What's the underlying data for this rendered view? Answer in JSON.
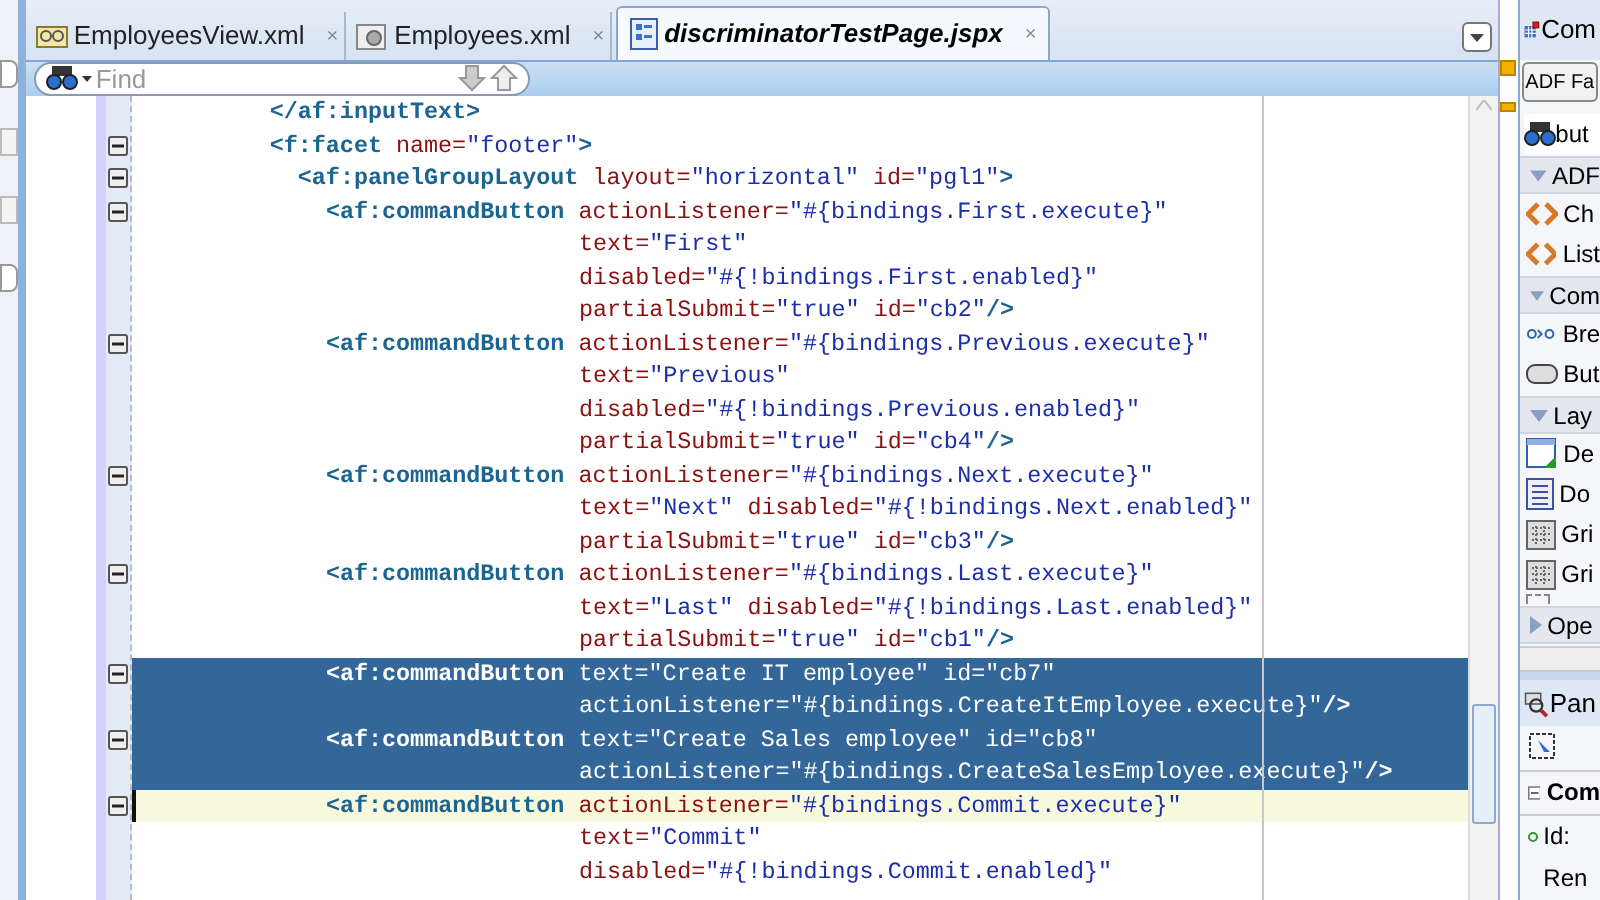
{
  "tabs": [
    {
      "label": "EmployeesView.xml",
      "kind": "view",
      "selected": false,
      "close": "×"
    },
    {
      "label": "Employees.xml",
      "kind": "entity",
      "selected": false,
      "close": "×"
    },
    {
      "label": "discriminatorTestPage.jspx",
      "kind": "page",
      "selected": true,
      "close": "×"
    }
  ],
  "find": {
    "placeholder": "Find"
  },
  "code": [
    {
      "fold": false,
      "lines": [
        {
          "selected": false,
          "current": false,
          "tokens": [
            {
              "kind": "tag",
              "text": "</af:inputText>"
            }
          ]
        }
      ]
    },
    {
      "fold": true,
      "lines": [
        {
          "selected": false,
          "current": false,
          "tokens": [
            {
              "kind": "tag",
              "text": "<f:facet "
            },
            {
              "kind": "attr",
              "text": "name="
            },
            {
              "kind": "value",
              "text": "\"footer\""
            },
            {
              "kind": "tag",
              "text": ">"
            }
          ]
        }
      ],
      "children": [
        {
          "fold": true,
          "lines": [
            {
              "selected": false,
              "current": false,
              "tokens": [
                {
                  "kind": "tag",
                  "text": "<af:panelGroupLayout "
                },
                {
                  "kind": "attr",
                  "text": "layout="
                },
                {
                  "kind": "value",
                  "text": "\"horizontal\" "
                },
                {
                  "kind": "attr",
                  "text": "id="
                },
                {
                  "kind": "value",
                  "text": "\"pgl1\""
                },
                {
                  "kind": "tag",
                  "text": ">"
                }
              ]
            }
          ],
          "children": [
            {
              "fold": true,
              "lines": [
                {
                  "selected": false,
                  "current": false,
                  "tokens": [
                    {
                      "kind": "tag",
                      "text": "<af:commandButton "
                    },
                    {
                      "kind": "attr",
                      "text": "actionListener="
                    },
                    {
                      "kind": "value",
                      "text": "\"#{bindings.First.execute}\""
                    }
                  ]
                },
                {
                  "selected": false,
                  "current": false,
                  "tokens": [
                    {
                      "kind": "attr",
                      "text": "text="
                    },
                    {
                      "kind": "value",
                      "text": "\"First\""
                    }
                  ]
                },
                {
                  "selected": false,
                  "current": false,
                  "tokens": [
                    {
                      "kind": "attr",
                      "text": "disabled="
                    },
                    {
                      "kind": "value",
                      "text": "\"#{!bindings.First.enabled}\""
                    }
                  ]
                },
                {
                  "selected": false,
                  "current": false,
                  "tokens": [
                    {
                      "kind": "attr",
                      "text": "partialSubmit="
                    },
                    {
                      "kind": "value",
                      "text": "\"true\" "
                    },
                    {
                      "kind": "attr",
                      "text": "id="
                    },
                    {
                      "kind": "value",
                      "text": "\"cb2\""
                    },
                    {
                      "kind": "tag",
                      "text": "/>"
                    }
                  ]
                }
              ]
            },
            {
              "fold": true,
              "lines": [
                {
                  "selected": false,
                  "current": false,
                  "tokens": [
                    {
                      "kind": "tag",
                      "text": "<af:commandButton "
                    },
                    {
                      "kind": "attr",
                      "text": "actionListener="
                    },
                    {
                      "kind": "value",
                      "text": "\"#{bindings.Previous.execute}\""
                    }
                  ]
                },
                {
                  "selected": false,
                  "current": false,
                  "tokens": [
                    {
                      "kind": "attr",
                      "text": "text="
                    },
                    {
                      "kind": "value",
                      "text": "\"Previous\""
                    }
                  ]
                },
                {
                  "selected": false,
                  "current": false,
                  "tokens": [
                    {
                      "kind": "attr",
                      "text": "disabled="
                    },
                    {
                      "kind": "value",
                      "text": "\"#{!bindings.Previous.enabled}\""
                    }
                  ]
                },
                {
                  "selected": false,
                  "current": false,
                  "tokens": [
                    {
                      "kind": "attr",
                      "text": "partialSubmit="
                    },
                    {
                      "kind": "value",
                      "text": "\"true\" "
                    },
                    {
                      "kind": "attr",
                      "text": "id="
                    },
                    {
                      "kind": "value",
                      "text": "\"cb4\""
                    },
                    {
                      "kind": "tag",
                      "text": "/>"
                    }
                  ]
                }
              ]
            },
            {
              "fold": true,
              "lines": [
                {
                  "selected": false,
                  "current": false,
                  "tokens": [
                    {
                      "kind": "tag",
                      "text": "<af:commandButton "
                    },
                    {
                      "kind": "attr",
                      "text": "actionListener="
                    },
                    {
                      "kind": "value",
                      "text": "\"#{bindings.Next.execute}\""
                    }
                  ]
                },
                {
                  "selected": false,
                  "current": false,
                  "tokens": [
                    {
                      "kind": "attr",
                      "text": "text="
                    },
                    {
                      "kind": "value",
                      "text": "\"Next\" "
                    },
                    {
                      "kind": "attr",
                      "text": "disabled="
                    },
                    {
                      "kind": "value",
                      "text": "\"#{!bindings.Next.enabled}\""
                    }
                  ]
                },
                {
                  "selected": false,
                  "current": false,
                  "tokens": [
                    {
                      "kind": "attr",
                      "text": "partialSubmit="
                    },
                    {
                      "kind": "value",
                      "text": "\"true\" "
                    },
                    {
                      "kind": "attr",
                      "text": "id="
                    },
                    {
                      "kind": "value",
                      "text": "\"cb3\""
                    },
                    {
                      "kind": "tag",
                      "text": "/>"
                    }
                  ]
                }
              ]
            },
            {
              "fold": true,
              "lines": [
                {
                  "selected": false,
                  "current": false,
                  "tokens": [
                    {
                      "kind": "tag",
                      "text": "<af:commandButton "
                    },
                    {
                      "kind": "attr",
                      "text": "actionListener="
                    },
                    {
                      "kind": "value",
                      "text": "\"#{bindings.Last.execute}\""
                    }
                  ]
                },
                {
                  "selected": false,
                  "current": false,
                  "tokens": [
                    {
                      "kind": "attr",
                      "text": "text="
                    },
                    {
                      "kind": "value",
                      "text": "\"Last\" "
                    },
                    {
                      "kind": "attr",
                      "text": "disabled="
                    },
                    {
                      "kind": "value",
                      "text": "\"#{!bindings.Last.enabled}\""
                    }
                  ]
                },
                {
                  "selected": false,
                  "current": false,
                  "tokens": [
                    {
                      "kind": "attr",
                      "text": "partialSubmit="
                    },
                    {
                      "kind": "value",
                      "text": "\"true\" "
                    },
                    {
                      "kind": "attr",
                      "text": "id="
                    },
                    {
                      "kind": "value",
                      "text": "\"cb1\""
                    },
                    {
                      "kind": "tag",
                      "text": "/>"
                    }
                  ]
                }
              ]
            },
            {
              "fold": true,
              "lines": [
                {
                  "selected": true,
                  "current": false,
                  "tokens": [
                    {
                      "kind": "tag",
                      "text": "<af:commandButton "
                    },
                    {
                      "kind": "attr",
                      "text": "text="
                    },
                    {
                      "kind": "value",
                      "text": "\"Create IT employee\" "
                    },
                    {
                      "kind": "attr",
                      "text": "id="
                    },
                    {
                      "kind": "value",
                      "text": "\"cb7\""
                    }
                  ]
                },
                {
                  "selected": true,
                  "current": false,
                  "tokens": [
                    {
                      "kind": "attr",
                      "text": "actionListener="
                    },
                    {
                      "kind": "value",
                      "text": "\"#{bindings.CreateItEmployee.execute}\""
                    },
                    {
                      "kind": "tag",
                      "text": "/>"
                    }
                  ]
                }
              ]
            },
            {
              "fold": true,
              "lines": [
                {
                  "selected": true,
                  "current": false,
                  "tokens": [
                    {
                      "kind": "tag",
                      "text": "<af:commandButton "
                    },
                    {
                      "kind": "attr",
                      "text": "text="
                    },
                    {
                      "kind": "value",
                      "text": "\"Create Sales employee\" "
                    },
                    {
                      "kind": "attr",
                      "text": "id="
                    },
                    {
                      "kind": "value",
                      "text": "\"cb8\""
                    }
                  ]
                },
                {
                  "selected": true,
                  "current": false,
                  "tokens": [
                    {
                      "kind": "attr",
                      "text": "actionListener="
                    },
                    {
                      "kind": "value",
                      "text": "\"#{bindings.CreateSalesEmployee.execute}\""
                    },
                    {
                      "kind": "tag",
                      "text": "/>"
                    }
                  ]
                }
              ]
            },
            {
              "fold": true,
              "lines": [
                {
                  "selected": false,
                  "current": true,
                  "tokens": [
                    {
                      "kind": "tag",
                      "text": "<af:commandButton "
                    },
                    {
                      "kind": "attr",
                      "text": "actionListener="
                    },
                    {
                      "kind": "value",
                      "text": "\"#{bindings.Commit.execute}\""
                    }
                  ]
                },
                {
                  "selected": false,
                  "current": false,
                  "tokens": [
                    {
                      "kind": "attr",
                      "text": "text="
                    },
                    {
                      "kind": "value",
                      "text": "\"Commit\""
                    }
                  ]
                },
                {
                  "selected": false,
                  "current": false,
                  "tokens": [
                    {
                      "kind": "attr",
                      "text": "disabled="
                    },
                    {
                      "kind": "value",
                      "text": "\"#{!bindings.Commit.enabled}\""
                    }
                  ]
                }
              ]
            }
          ]
        }
      ]
    }
  ],
  "palette": {
    "title": "Com",
    "library": "ADF Fa",
    "search": "but",
    "sections": [
      {
        "label": "ADF",
        "expanded": true,
        "items": [
          {
            "label": "Ch",
            "kind": "tag"
          },
          {
            "label": "List",
            "kind": "tag"
          }
        ]
      },
      {
        "label": "Com",
        "expanded": true,
        "items": [
          {
            "label": "Bre",
            "kind": "crumbs"
          },
          {
            "label": "But",
            "kind": "button"
          }
        ]
      },
      {
        "label": "Lay",
        "expanded": true,
        "items": [
          {
            "label": "De",
            "kind": "window"
          },
          {
            "label": "Do",
            "kind": "doc"
          },
          {
            "label": "Gri",
            "kind": "grid"
          },
          {
            "label": "Gri",
            "kind": "grid"
          }
        ]
      },
      {
        "label": "Ope",
        "expanded": false
      }
    ]
  },
  "properties": {
    "title": "Pan",
    "section": {
      "label": "Com",
      "expanded": true
    },
    "fields": [
      "Id:",
      "Ren"
    ]
  }
}
